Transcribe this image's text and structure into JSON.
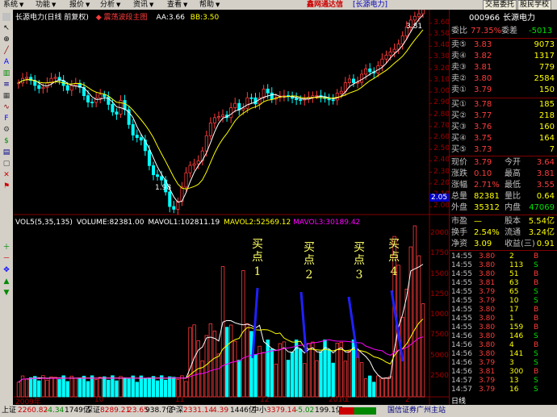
{
  "menu": {
    "items": [
      {
        "label": "系统"
      },
      {
        "label": "功能"
      },
      {
        "label": "报价"
      },
      {
        "label": "分析"
      },
      {
        "label": "资讯"
      },
      {
        "label": "查看"
      },
      {
        "label": "帮助"
      }
    ],
    "brand": "鑫网通达信",
    "stock_tag": "[长源电力]",
    "btn_trade": "交易委托",
    "btn_school": "股民学校"
  },
  "chart_header": {
    "name": "长源电力(日线 前复权)",
    "indicator": "◆ 震荡波段主图",
    "aa": "AA:3.66",
    "bb": "BB:3.50"
  },
  "vol_header": {
    "vol": "VOL5(5,35,135)",
    "volume": "VOLUME:82381.00",
    "mavol1": "MAVOL1:102811.19",
    "mavol2": "MAVOL2:52569.12",
    "mavol3": "MAVOL3:30189.42"
  },
  "price_axis": [
    "3.60",
    "3.50",
    "3.40",
    "3.30",
    "3.20",
    "3.10",
    "3.00",
    "2.90",
    "2.80",
    "2.70",
    "2.60",
    "2.50",
    "2.40",
    "2.30",
    "2.20",
    "2.10",
    "2.00"
  ],
  "vol_axis": [
    "20000",
    "17500",
    "15000",
    "12500",
    "10000",
    "7500",
    "5000",
    "2500"
  ],
  "price_marker": "2.05",
  "high_label": "3.81",
  "low_label": "1.98",
  "time_axis": [
    "2009年",
    "10",
    "11",
    "12",
    "2010",
    "1",
    "2"
  ],
  "annotations": [
    {
      "text": "买点",
      "num": "1"
    },
    {
      "text": "买点",
      "num": "2"
    },
    {
      "text": "买点",
      "num": "3"
    },
    {
      "text": "买点",
      "num": "4"
    }
  ],
  "quote": {
    "code": "000966",
    "name": "长源电力",
    "weibi_label": "委比",
    "weibi": "77.35%",
    "weicha_label": "委差",
    "weicha": "-5013",
    "sells": [
      {
        "label": "卖⑤",
        "price": "3.83",
        "vol": "9073"
      },
      {
        "label": "卖④",
        "price": "3.82",
        "vol": "1317"
      },
      {
        "label": "卖③",
        "price": "3.81",
        "vol": "779"
      },
      {
        "label": "卖②",
        "price": "3.80",
        "vol": "2584"
      },
      {
        "label": "卖①",
        "price": "3.79",
        "vol": "150"
      }
    ],
    "buys": [
      {
        "label": "买①",
        "price": "3.78",
        "vol": "185"
      },
      {
        "label": "买②",
        "price": "3.77",
        "vol": "218"
      },
      {
        "label": "买③",
        "price": "3.76",
        "vol": "160"
      },
      {
        "label": "买④",
        "price": "3.75",
        "vol": "164"
      },
      {
        "label": "买⑤",
        "price": "3.73",
        "vol": "7"
      }
    ],
    "stats": [
      {
        "l1": "现价",
        "v1": "3.79",
        "l2": "今开",
        "v2": "3.64"
      },
      {
        "l1": "涨跌",
        "v1": "0.10",
        "l2": "最高",
        "v2": "3.81"
      },
      {
        "l1": "涨幅",
        "v1": "2.71%",
        "l2": "最低",
        "v2": "3.55"
      },
      {
        "l1": "总量",
        "v1": "82381",
        "l2": "量比",
        "v2": "0.64"
      },
      {
        "l1": "外盘",
        "v1": "35312",
        "l2": "内盘",
        "v2": "47069"
      }
    ],
    "fin": [
      {
        "l1": "市盈",
        "v1": "—",
        "l2": "股本",
        "v2": "5.54亿"
      },
      {
        "l1": "换手",
        "v1": "2.54%",
        "l2": "流通",
        "v2": "3.24亿"
      },
      {
        "l1": "净资",
        "v1": "3.09",
        "l2": "收益(三)",
        "v2": "0.91"
      }
    ],
    "ticks": [
      {
        "t": "14:55",
        "p": "3.80",
        "v": "2",
        "s": "B"
      },
      {
        "t": "14:55",
        "p": "3.80",
        "v": "113",
        "s": "S"
      },
      {
        "t": "14:55",
        "p": "3.80",
        "v": "51",
        "s": "B"
      },
      {
        "t": "14:55",
        "p": "3.81",
        "v": "63",
        "s": "B"
      },
      {
        "t": "14:55",
        "p": "3.79",
        "v": "65",
        "s": "S"
      },
      {
        "t": "14:55",
        "p": "3.79",
        "v": "10",
        "s": "S"
      },
      {
        "t": "14:55",
        "p": "3.80",
        "v": "17",
        "s": "B"
      },
      {
        "t": "14:55",
        "p": "3.80",
        "v": "1",
        "s": "B"
      },
      {
        "t": "14:55",
        "p": "3.80",
        "v": "159",
        "s": "B"
      },
      {
        "t": "14:56",
        "p": "3.80",
        "v": "146",
        "s": "S"
      },
      {
        "t": "14:56",
        "p": "3.80",
        "v": "4",
        "s": "B"
      },
      {
        "t": "14:56",
        "p": "3.80",
        "v": "141",
        "s": "S"
      },
      {
        "t": "14:56",
        "p": "3.79",
        "v": "3",
        "s": "S"
      },
      {
        "t": "14:56",
        "p": "3.81",
        "v": "300",
        "s": "B"
      },
      {
        "t": "14:57",
        "p": "3.79",
        "v": "13",
        "s": "S"
      },
      {
        "t": "14:57",
        "p": "3.79",
        "v": "16",
        "s": "S"
      }
    ],
    "tab_label": "日线"
  },
  "status": {
    "sh_label": "上证",
    "sh_val": "2260.82",
    "sh_chg": "-4.34",
    "sh_amt": "1749亿",
    "sz_label": "深证",
    "sz_val": "8289.21",
    "sz_chg": "23.65",
    "sz_amt": "938.7亿",
    "hs_label": "沪深",
    "hs_val": "2331.14",
    "hs_chg": "4.39",
    "hs_amt": "1446亿",
    "zx_label": "中小",
    "zx_val": "3379.14",
    "zx_chg": "-5.02",
    "zx_amt": "199.1亿",
    "broker": "国信证券广州主站"
  },
  "colors": {
    "up": "#ff3b3b",
    "down": "#00ffff",
    "grid": "#800000",
    "ma1": "#ffffff",
    "ma2": "#ffff00",
    "ma3": "#ff00ff"
  }
}
